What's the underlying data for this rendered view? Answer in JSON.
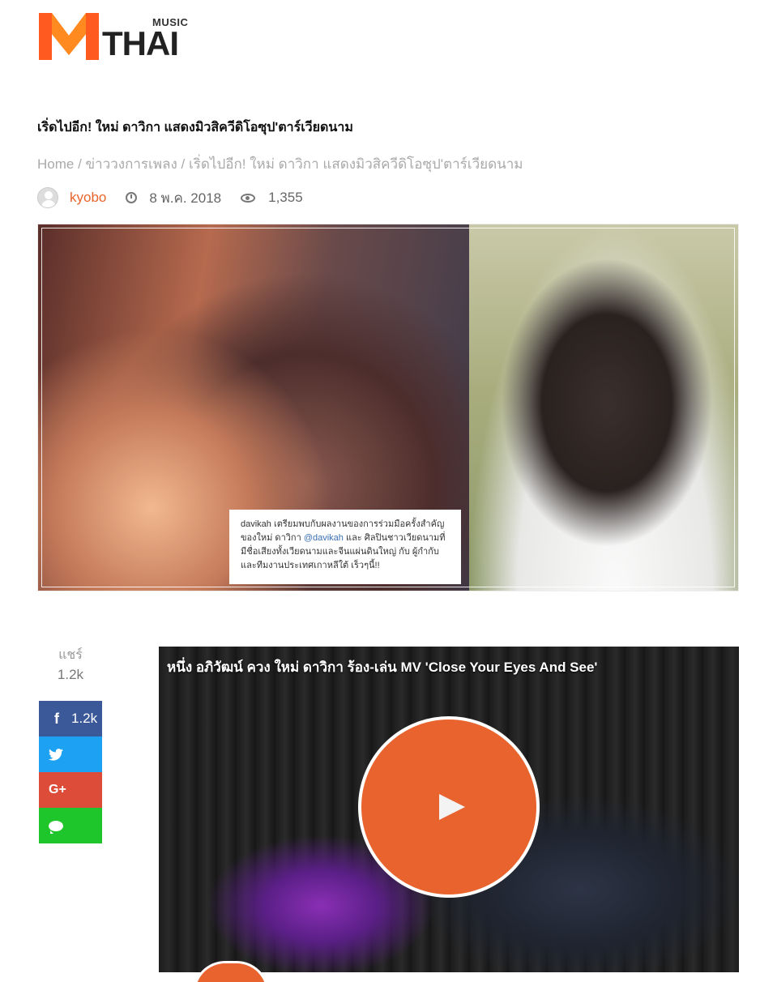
{
  "logo": {
    "music": "MUSIC",
    "thai": "THAI",
    "brand_color": "#ff5a1f"
  },
  "article": {
    "title": "เริ่ดไปอีก! ใหม่ ดาวิกา แสดงมิวสิควีดิโอซุป'ตาร์เวียดนาม",
    "breadcrumb": {
      "home": "Home",
      "sep": " / ",
      "category": "ข่าววงการเพลง",
      "current": "เริ่ดไปอีก! ใหม่ ดาวิกา แสดงมิวสิควีดิโอซุป'ตาร์เวียดนาม"
    },
    "author": "kyobo",
    "date": "8 พ.ค. 2018",
    "views": "1,355"
  },
  "hero_caption": {
    "line1_handle": "davikah",
    "line1_text": " เตรียมพบกับผลงานของการร่วมมือครั้งสำคัญของใหม่ ดาวิกา ",
    "line1_tag": "@davikah",
    "line2_text": " และ ศิลปินชาวเวียดนามที่มีชื่อเสียงทั้งเวียดนามและจีนแผ่นดินใหญ่ กับ ผู้กำกับและทีมงานประเทศเกาหลีใต้ เร็วๆนี้!!"
  },
  "share": {
    "label": "แชร์",
    "count": "1.2k",
    "facebook_count": "1.2k",
    "facebook_color": "#3b5998",
    "twitter_color": "#1da1f2",
    "google_color": "#dd4b39",
    "comment_color": "#1ec62b"
  },
  "video": {
    "title": "หนึ่ง อภิวัฒน์ ควง ใหม่ ดาวิกา ร้อง-เล่น MV 'Close Your Eyes And See'",
    "accent_color": "#e8632d"
  }
}
